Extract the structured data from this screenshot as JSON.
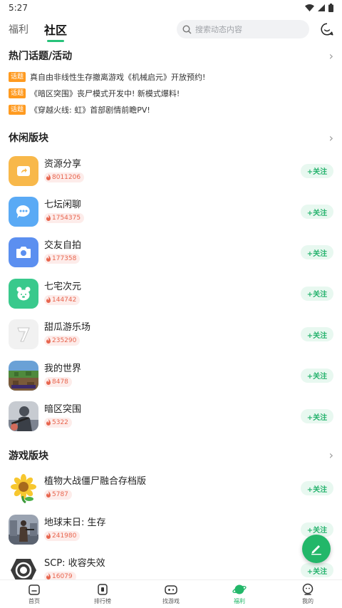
{
  "status": {
    "time": "5:27"
  },
  "header": {
    "tabs": [
      {
        "label": "福利"
      },
      {
        "label": "社区"
      }
    ],
    "search_placeholder": "搜索动态内容"
  },
  "hot_topics": {
    "title": "热门话题/活动",
    "badge": "话题",
    "items": [
      {
        "text": "真自由非线性生存撤离游戏《机械启元》开放预约!"
      },
      {
        "text": "《暗区突围》丧尸模式开发中! 新模式爆料!"
      },
      {
        "text": "《穿越火线: 虹》首部剧情前瞻PV!"
      }
    ]
  },
  "leisure": {
    "title": "休闲版块",
    "follow_label": "+关注",
    "items": [
      {
        "name": "资源分享",
        "heat": "8011206",
        "icon": "share-icon",
        "color": "#f8b84a"
      },
      {
        "name": "七坛闲聊",
        "heat": "1754375",
        "icon": "chat-bubble-icon",
        "color": "#5aaaf5"
      },
      {
        "name": "交友自拍",
        "heat": "177358",
        "icon": "camera-icon",
        "color": "#5b8ff0"
      },
      {
        "name": "七宅次元",
        "heat": "144742",
        "icon": "bear-icon",
        "color": "#39c98c"
      },
      {
        "name": "甜瓜游乐场",
        "heat": "235290",
        "icon": "melon-playground-icon",
        "color": "#f1f1f1"
      },
      {
        "name": "我的世界",
        "heat": "8478",
        "icon": "minecraft-icon",
        "color": "#4f8a3c"
      },
      {
        "name": "暗区突围",
        "heat": "5322",
        "icon": "arena-breakout-icon",
        "color": "#6b7480"
      }
    ]
  },
  "games": {
    "title": "游戏版块",
    "items": [
      {
        "name": "植物大战僵尸融合存档版",
        "heat": "5787",
        "icon": "sunflower-icon",
        "color": "#f7d54a"
      },
      {
        "name": "地球末日: 生存",
        "heat": "241980",
        "icon": "last-day-earth-icon",
        "color": "#7c8799"
      },
      {
        "name": "SCP: 收容失效",
        "heat": "16079",
        "icon": "scp-logo-icon",
        "color": "#3a3a3a"
      }
    ]
  },
  "bottom_nav": [
    {
      "label": "首页",
      "icon": "home-icon"
    },
    {
      "label": "排行榜",
      "icon": "ranking-icon"
    },
    {
      "label": "找游戏",
      "icon": "gamepad-icon"
    },
    {
      "label": "福利",
      "icon": "welfare-planet-icon"
    },
    {
      "label": "我的",
      "icon": "profile-icon"
    }
  ],
  "accent_color": "#22b769"
}
